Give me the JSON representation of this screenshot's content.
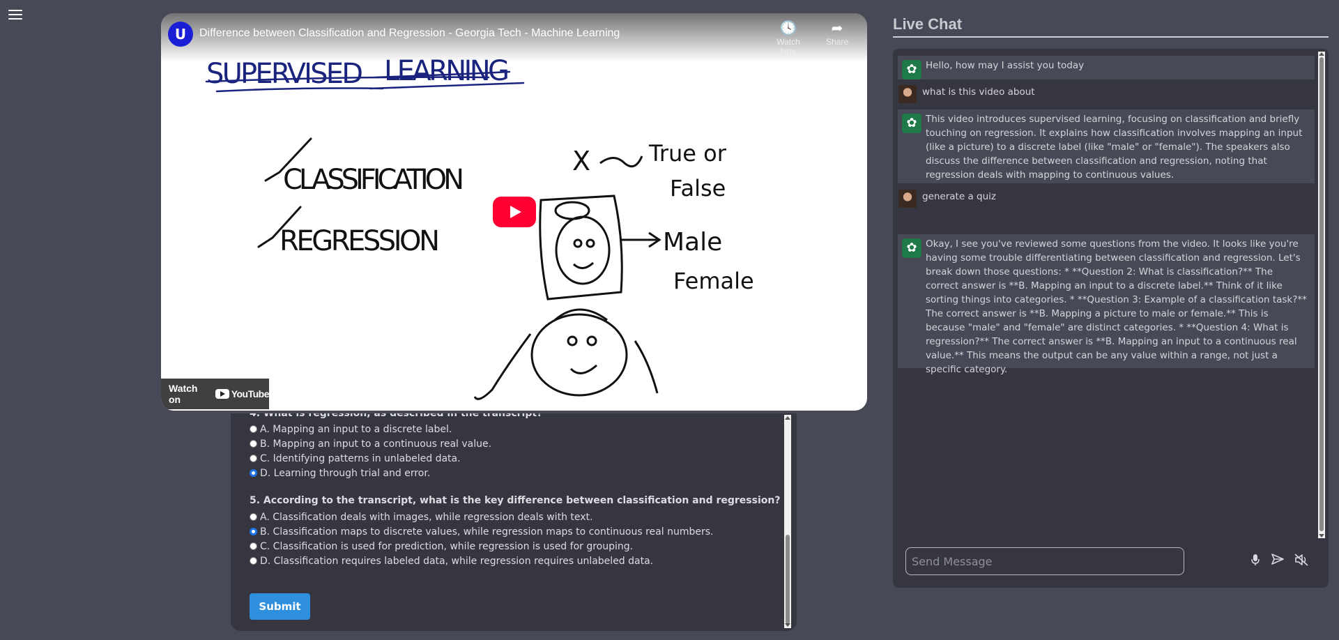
{
  "video": {
    "channel_logo": "U",
    "title": "Difference between Classification and Regression - Georgia Tech - Machine Learning",
    "watch_later_label": "Watch later",
    "share_label": "Share",
    "watch_on_label": "Watch on",
    "youtube_label": "YouTube",
    "whiteboard": {
      "heading": "SUPERVISED LEARNING",
      "item1": "CLASSIFICATION",
      "item2": "REGRESSION",
      "arrow_label": "True or False",
      "label_male": "Male",
      "label_female": "Female"
    }
  },
  "quiz": {
    "partial_question": "4. What is regression, as described in the transcript?",
    "q4_options": [
      {
        "label": "A. Mapping an input to a discrete label.",
        "checked": false
      },
      {
        "label": "B. Mapping an input to a continuous real value.",
        "checked": false
      },
      {
        "label": "C. Identifying patterns in unlabeled data.",
        "checked": false
      },
      {
        "label": "D. Learning through trial and error.",
        "checked": true
      }
    ],
    "q5_title": "5. According to the transcript, what is the key difference between classification and regression?",
    "q5_options": [
      {
        "label": "A. Classification deals with images, while regression deals with text.",
        "checked": false
      },
      {
        "label": "B. Classification maps to discrete values, while regression maps to continuous real numbers.",
        "checked": true
      },
      {
        "label": "C. Classification is used for prediction, while regression is used for grouping.",
        "checked": false
      },
      {
        "label": "D. Classification requires labeled data, while regression requires unlabeled data.",
        "checked": false
      }
    ],
    "submit_label": "Submit"
  },
  "chat": {
    "title": "Live Chat",
    "messages": [
      {
        "role": "bot",
        "text": "Hello, how may I assist you today"
      },
      {
        "role": "user",
        "text": "what is this video about"
      },
      {
        "role": "bot",
        "text": "This video introduces supervised learning, focusing on classification and briefly touching on regression. It explains how classification involves mapping an input (like a picture) to a discrete label (like \"male\" or \"female\"). The speakers also discuss the difference between classification and regression, noting that regression deals with mapping to continuous values."
      },
      {
        "role": "user",
        "text": "generate a quiz"
      },
      {
        "role": "bot",
        "text": "Okay, I see you've reviewed some questions from the video. It looks like you're having some trouble differentiating between classification and regression. Let's break down those questions: * **Question 2: What is classification?** The correct answer is **B. Mapping an input to a discrete label.** Think of it like sorting things into categories. * **Question 3: Example of a classification task?** The correct answer is **B. Mapping a picture to male or female.** This is because \"male\" and \"female\" are distinct categories. * **Question 4: What is regression?** The correct answer is **B. Mapping an input to a continuous real value.** This means the output can be any value within a range, not just a specific category."
      }
    ],
    "input_placeholder": "Send Message",
    "icons": [
      "microphone-icon",
      "send-icon",
      "mute-icon"
    ]
  }
}
